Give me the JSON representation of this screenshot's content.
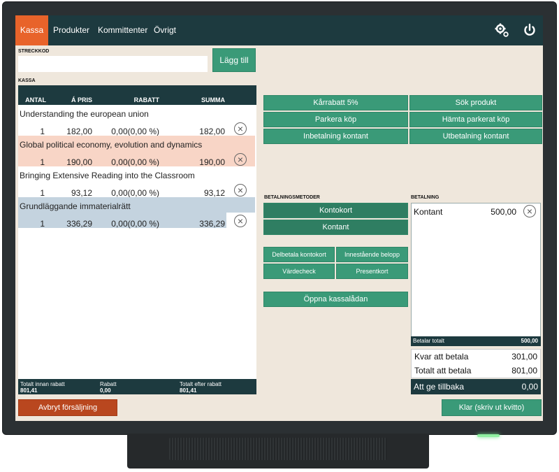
{
  "nav": {
    "tabs": [
      "Kassa",
      "Produkter",
      "Kommittenter",
      "Övrigt"
    ]
  },
  "barcode": {
    "label": "STRECKKOD",
    "value": "",
    "add_button": "Lägg till"
  },
  "cart": {
    "label": "KASSA",
    "headers": {
      "qty": "ANTAL",
      "price": "Á PRIS",
      "discount": "RABATT",
      "sum": "SUMMA"
    },
    "items": [
      {
        "name": "Understanding the european union",
        "qty": "1",
        "price": "182,00",
        "discount": "0,00(0,00 %)",
        "sum": "182,00"
      },
      {
        "name": "Global political economy, evolution and dynamics",
        "qty": "1",
        "price": "190,00",
        "discount": "0,00(0,00 %)",
        "sum": "190,00"
      },
      {
        "name": "Bringing Extensive Reading into the Classroom",
        "qty": "1",
        "price": "93,12",
        "discount": "0,00(0,00 %)",
        "sum": "93,12"
      },
      {
        "name": "Grundläggande immaterialrätt",
        "qty": "1",
        "price": "336,29",
        "discount": "0,00(0,00 %)",
        "sum": "336,29"
      }
    ],
    "row_colors": [
      "#ffffff",
      "#f8d5c6",
      "#ffffff",
      "#c4d3df"
    ],
    "footer": {
      "total_before_label": "Totalt innan rabatt",
      "total_before": "801,41",
      "discount_label": "Rabatt",
      "discount": "0,00",
      "total_after_label": "Totalt efter rabatt",
      "total_after": "801,41"
    },
    "cancel_button": "Avbryt försäljning"
  },
  "actions": {
    "student_discount": "Kårrabatt 5%",
    "search_product": "Sök produkt",
    "park": "Parkera köp",
    "fetch_parked": "Hämta parkerat köp",
    "cash_in": "Inbetalning kontant",
    "cash_out": "Utbetalning kontant"
  },
  "methods": {
    "label": "BETALNINGSMETODER",
    "card": "Kontokort",
    "cash": "Kontant",
    "split_card": "Delbetala kontokort",
    "outstanding": "Innestående belopp",
    "voucher": "Värdecheck",
    "giftcard": "Presentkort",
    "open_drawer": "Öppna kassalådan"
  },
  "payment": {
    "label": "BETALNING",
    "entries": [
      {
        "method": "Kontant",
        "amount": "500,00"
      }
    ],
    "paid_total_label": "Betalar totalt",
    "paid_total": "500,00",
    "remaining_label": "Kvar att betala",
    "remaining": "301,00",
    "total_label": "Totalt att betala",
    "total": "801,00",
    "change_label": "Att ge tillbaka",
    "change": "0,00",
    "done_button": "Klar (skriv ut kvitto)"
  },
  "colors": {
    "accent": "#e8632a",
    "bar": "#1d3a3f",
    "button": "#3a9a78",
    "cancel": "#b9471f",
    "background": "#efe7dc"
  },
  "icons": {
    "settings": "gears-icon",
    "power": "power-icon",
    "remove": "remove-circle-icon"
  }
}
